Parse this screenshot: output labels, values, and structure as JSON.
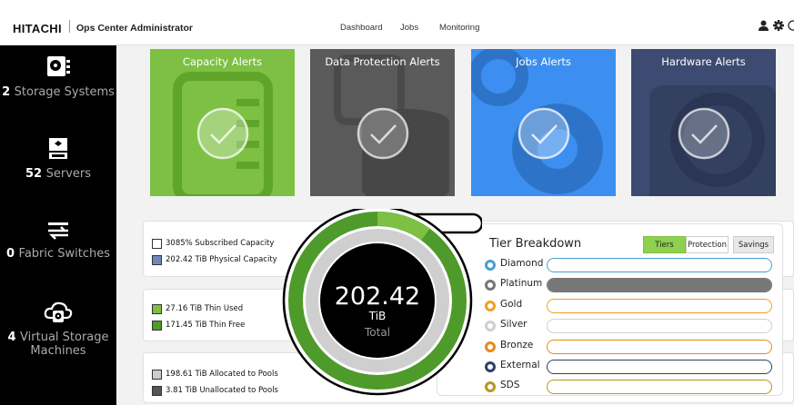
{
  "header": {
    "brand": "HITACHI",
    "app_name": "Ops Center Administrator",
    "nav": [
      "Dashboard",
      "Jobs",
      "Monitoring"
    ],
    "icons": [
      "user-icon",
      "gear-icon",
      "help-icon"
    ]
  },
  "sidebar": {
    "items": [
      {
        "count": "2",
        "label": "Storage Systems",
        "icon": "storage-icon"
      },
      {
        "count": "52",
        "label": "Servers",
        "icon": "server-icon"
      },
      {
        "count": "0",
        "label": "Fabric Switches",
        "icon": "switch-icon"
      },
      {
        "count": "4",
        "label": "Virtual Storage Machines",
        "icon": "cloud-storage-icon"
      }
    ]
  },
  "alerts": [
    {
      "title": "Capacity Alerts",
      "color": "#7dc043"
    },
    {
      "title": "Data Protection Alerts",
      "color": "#5a5a5a"
    },
    {
      "title": "Jobs Alerts",
      "color": "#3c8ff0"
    },
    {
      "title": "Hardware Alerts",
      "color": "#3d4a72"
    }
  ],
  "capacity": {
    "subscribed": "3085% Subscribed Capacity",
    "physical": "202.42 TiB Physical Capacity",
    "thin_used": "27.16 TiB Thin Used",
    "thin_free": "171.45 TiB Thin Free",
    "allocated": "198.61 TiB Allocated to Pools",
    "unallocated": "3.81 TiB Unallocated to Pools"
  },
  "donut": {
    "value": "202.42",
    "unit": "TiB",
    "label": "Total"
  },
  "tiers": {
    "title": "Tier Breakdown",
    "buttons": [
      "Tiers",
      "Protection",
      "Savings"
    ],
    "active_button": "Tiers",
    "rows": [
      {
        "name": "Diamond",
        "color": "#4a9fd0",
        "fill": 0.0
      },
      {
        "name": "Platinum",
        "color": "#777777",
        "fill": 1.0
      },
      {
        "name": "Gold",
        "color": "#f0a020",
        "fill": 0.0
      },
      {
        "name": "Silver",
        "color": "#cfcfcf",
        "fill": 0.0
      },
      {
        "name": "Bronze",
        "color": "#e58a1b",
        "fill": 0.0
      },
      {
        "name": "External",
        "color": "#2f3f6e",
        "fill": 0.0
      },
      {
        "name": "SDS",
        "color": "#b8961e",
        "fill": 0.0
      }
    ]
  }
}
